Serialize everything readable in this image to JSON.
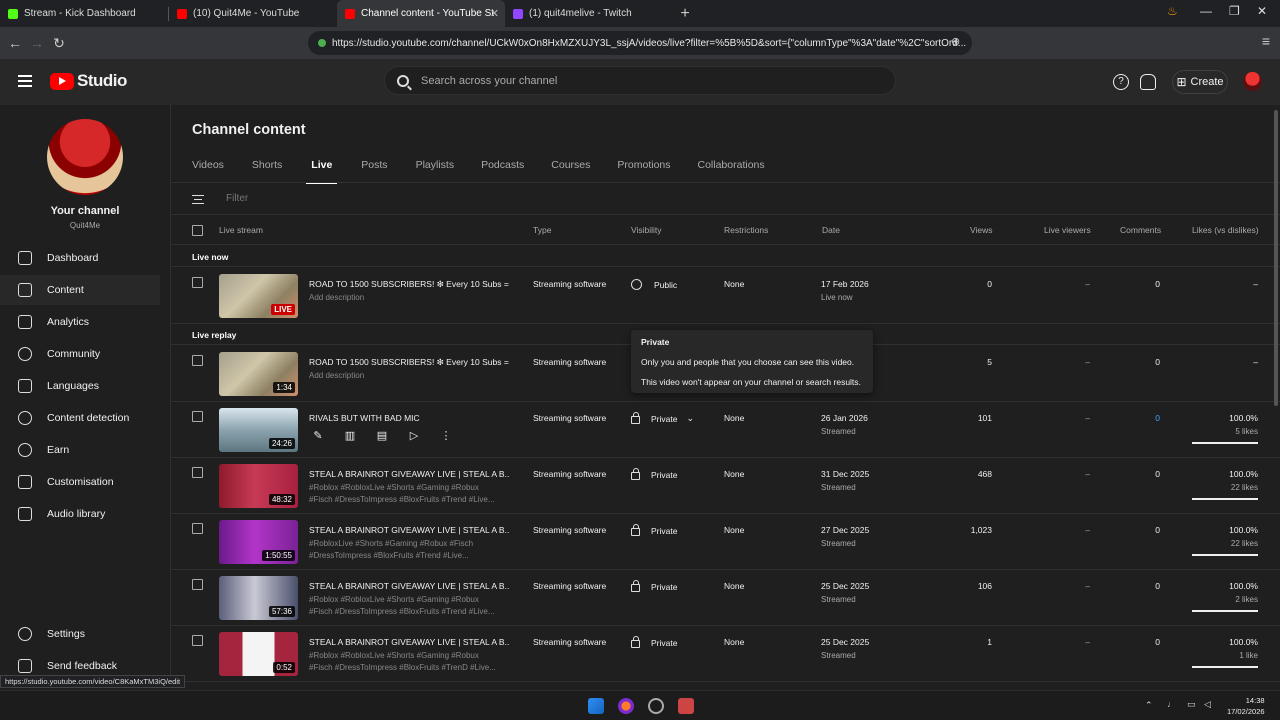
{
  "browser": {
    "tabs": [
      {
        "label": "Stream - Kick Dashboard",
        "color": "#53fc18",
        "active": false
      },
      {
        "label": "(10) Quit4Me - YouTube",
        "color": "#ff0000",
        "active": false
      },
      {
        "label": "Channel content - YouTube St",
        "color": "#ff0000",
        "active": true
      },
      {
        "label": "(1) quit4melive - Twitch",
        "color": "#9146ff",
        "active": false
      }
    ],
    "url": "https://studio.youtube.com/channel/UCkW0xOn8HxMZXUJY3L_ssjA/videos/live?filter=%5B%5D&sort={\"columnType\"%3A\"date\"%2C\"sortOrd..."
  },
  "header": {
    "logo_text": "Studio",
    "search_placeholder": "Search across your channel",
    "create_label": "Create"
  },
  "sidebar": {
    "channel_title": "Your channel",
    "channel_handle": "Quit4Me",
    "items": [
      {
        "label": "Dashboard",
        "icon": "dashboard-icon"
      },
      {
        "label": "Content",
        "icon": "content-icon"
      },
      {
        "label": "Analytics",
        "icon": "analytics-icon"
      },
      {
        "label": "Community",
        "icon": "community-icon"
      },
      {
        "label": "Languages",
        "icon": "languages-icon"
      },
      {
        "label": "Content detection",
        "icon": "content-detection-icon"
      },
      {
        "label": "Earn",
        "icon": "earn-icon"
      },
      {
        "label": "Customisation",
        "icon": "customisation-icon"
      },
      {
        "label": "Audio library",
        "icon": "audio-library-icon"
      }
    ],
    "settings_label": "Settings",
    "feedback_label": "Send feedback"
  },
  "main": {
    "title": "Channel content",
    "tabs": [
      "Videos",
      "Shorts",
      "Live",
      "Posts",
      "Playlists",
      "Podcasts",
      "Courses",
      "Promotions",
      "Collaborations"
    ],
    "active_tab": "Live",
    "filter_placeholder": "Filter",
    "columns": {
      "stream": "Live stream",
      "type": "Type",
      "visibility": "Visibility",
      "restrictions": "Restrictions",
      "date": "Date",
      "views": "Views",
      "live_viewers": "Live viewers",
      "comments": "Comments",
      "likes": "Likes (vs dislikes)"
    },
    "section_live_now": "Live now",
    "section_live_replay": "Live replay",
    "live_now_row": {
      "title": "ROAD TO 1500 SUBSCRIBERS! ❇ Every 10 Subs =...",
      "desc": "Add description",
      "badge": "LIVE",
      "type": "Streaming software",
      "visibility": "Public",
      "restrictions": "None",
      "date": "17 Feb 2026",
      "date_sub": "Live now",
      "views": "0",
      "live_viewers": "–",
      "comments": "0",
      "likes": "–"
    },
    "replay_rows": [
      {
        "title": "ROAD TO 1500 SUBSCRIBERS! ❇ Every 10 Subs =...",
        "desc": "Add description",
        "duration": "1:34",
        "type": "Streaming software",
        "views": "5",
        "live_viewers": "–",
        "comments": "0",
        "likes": "–"
      },
      {
        "title": "RIVALS BUT WITH BAD MIC",
        "duration": "24:26",
        "type": "Streaming software",
        "visibility": "Private",
        "restrictions": "None",
        "date": "26 Jan 2026",
        "date_sub": "Streamed",
        "views": "101",
        "live_viewers": "–",
        "comments": "0",
        "likes": "100.0%",
        "likes_sub": "5 likes"
      },
      {
        "title": "STEAL A BRAINROT GIVEAWAY LIVE | STEAL A B...",
        "desc": "#Roblox #RobloxLive #Shorts #Gaming #Robux\n#Fisch #DressToImpress #BloxFruits #Trend #Live...",
        "duration": "48:32",
        "type": "Streaming software",
        "visibility": "Private",
        "restrictions": "None",
        "date": "31 Dec 2025",
        "date_sub": "Streamed",
        "views": "468",
        "live_viewers": "–",
        "comments": "0",
        "likes": "100.0%",
        "likes_sub": "22 likes"
      },
      {
        "title": "STEAL A BRAINROT GIVEAWAY LIVE | STEAL A B...",
        "desc": "#RobloxLive #Shorts #Gaming #Robux #Fisch\n#DressToImpress #BloxFruits #Trend #Live...",
        "duration": "1:50:55",
        "type": "Streaming software",
        "visibility": "Private",
        "restrictions": "None",
        "date": "27 Dec 2025",
        "date_sub": "Streamed",
        "views": "1,023",
        "live_viewers": "–",
        "comments": "0",
        "likes": "100.0%",
        "likes_sub": "22 likes"
      },
      {
        "title": "STEAL A BRAINROT GIVEAWAY LIVE | STEAL A B...",
        "desc": "#Roblox #RobloxLive #Shorts #Gaming #Robux\n#Fisch #DressToImpress #BloxFruits #Trend #Live...",
        "duration": "57:36",
        "type": "Streaming software",
        "visibility": "Private",
        "restrictions": "None",
        "date": "25 Dec 2025",
        "date_sub": "Streamed",
        "views": "106",
        "live_viewers": "–",
        "comments": "0",
        "likes": "100.0%",
        "likes_sub": "2 likes"
      },
      {
        "title": "STEAL A BRAINROT GIVEAWAY LIVE | STEAL A B...",
        "desc": "#Roblox #RobloxLive #Shorts #Gaming #Robux\n#Fisch #DressToImpress #BloxFruits #TrenD #Live...",
        "duration": "0:52",
        "type": "Streaming software",
        "visibility": "Private",
        "restrictions": "None",
        "date": "25 Dec 2025",
        "date_sub": "Streamed",
        "views": "1",
        "live_viewers": "–",
        "comments": "0",
        "likes": "100.0%",
        "likes_sub": "1 like"
      }
    ],
    "tooltip": {
      "title": "Private",
      "line1": "Only you and people that you choose can see this video.",
      "line2": "This video won't appear on your channel or search results."
    }
  },
  "status_url": "https://studio.youtube.com/video/C8KaMxTM3iQ/edit",
  "taskbar": {
    "time": "14:38",
    "date": "17/02/2026"
  },
  "colors": {
    "accent_red": "#ff0000",
    "live_badge": "#cc0000",
    "link_blue": "#3ea6ff"
  }
}
